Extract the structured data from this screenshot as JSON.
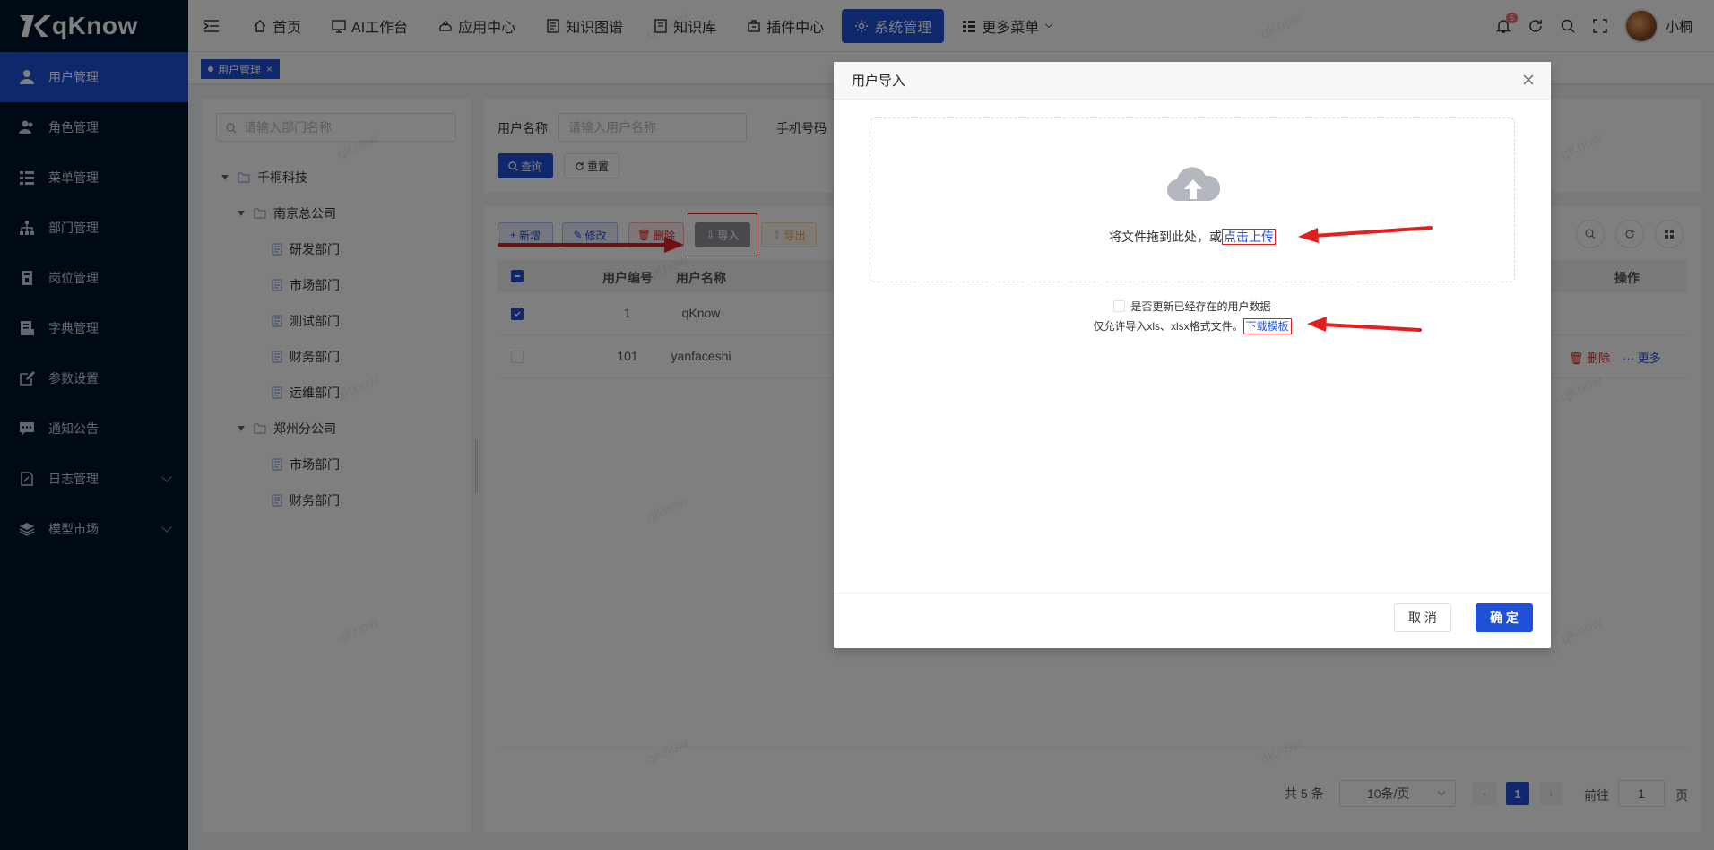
{
  "app": {
    "name": "qKnow",
    "watermark": "qKnow"
  },
  "sidebar": {
    "items": [
      {
        "label": "用户管理",
        "icon": "user-icon",
        "active": true
      },
      {
        "label": "角色管理",
        "icon": "users-icon"
      },
      {
        "label": "菜单管理",
        "icon": "menu-list-icon"
      },
      {
        "label": "部门管理",
        "icon": "org-tree-icon"
      },
      {
        "label": "岗位管理",
        "icon": "post-icon"
      },
      {
        "label": "字典管理",
        "icon": "dict-icon"
      },
      {
        "label": "参数设置",
        "icon": "edit-icon"
      },
      {
        "label": "通知公告",
        "icon": "message-icon"
      },
      {
        "label": "日志管理",
        "icon": "log-icon",
        "expandable": true
      },
      {
        "label": "模型市场",
        "icon": "model-icon",
        "expandable": true
      }
    ]
  },
  "topnav": {
    "items": [
      {
        "label": "首页",
        "icon": "home-icon"
      },
      {
        "label": "AI工作台",
        "icon": "monitor-icon"
      },
      {
        "label": "应用中心",
        "icon": "app-icon"
      },
      {
        "label": "知识图谱",
        "icon": "graph-icon"
      },
      {
        "label": "知识库",
        "icon": "book-icon"
      },
      {
        "label": "插件中心",
        "icon": "plugin-icon"
      },
      {
        "label": "系统管理",
        "icon": "gear-icon",
        "active": true
      },
      {
        "label": "更多菜单",
        "icon": "more-menu-icon"
      }
    ],
    "notification_count": "5",
    "username": "小桐"
  },
  "tags": {
    "active": "用户管理"
  },
  "dept": {
    "search_placeholder": "请输入部门名称",
    "tree": [
      {
        "label": "千桐科技",
        "level": 0,
        "type": "folder",
        "expanded": true
      },
      {
        "label": "南京总公司",
        "level": 1,
        "type": "folder",
        "expanded": true
      },
      {
        "label": "研发部门",
        "level": 2,
        "type": "doc"
      },
      {
        "label": "市场部门",
        "level": 2,
        "type": "doc"
      },
      {
        "label": "测试部门",
        "level": 2,
        "type": "doc"
      },
      {
        "label": "财务部门",
        "level": 2,
        "type": "doc"
      },
      {
        "label": "运维部门",
        "level": 2,
        "type": "doc"
      },
      {
        "label": "郑州分公司",
        "level": 1,
        "type": "folder",
        "expanded": true
      },
      {
        "label": "市场部门",
        "level": 2,
        "type": "doc"
      },
      {
        "label": "财务部门",
        "level": 2,
        "type": "doc"
      }
    ]
  },
  "query": {
    "username_label": "用户名称",
    "username_placeholder": "请输入用户名称",
    "phone_label": "手机号码",
    "search_btn": "查询",
    "reset_btn": "重置"
  },
  "toolbar": {
    "add": "新增",
    "edit": "修改",
    "delete": "删除",
    "import": "导入",
    "export": "导出"
  },
  "table": {
    "headers": [
      "用户编号",
      "用户名称",
      "操作"
    ],
    "rows": [
      {
        "id": "1",
        "name": "qKnow",
        "checked": true
      },
      {
        "id": "101",
        "name": "yanfaceshi",
        "checked": false
      }
    ],
    "row_actions": {
      "delete": "删除",
      "more": "更多"
    }
  },
  "pager": {
    "total": "共 5 条",
    "page_size": "10条/页",
    "current": "1",
    "goto_label": "前往",
    "goto_value": "1",
    "page_unit": "页"
  },
  "dialog": {
    "title": "用户导入",
    "drag_text": "将文件拖到此处，或",
    "click_upload": "点击上传",
    "update_existing": "是否更新已经存在的用户数据",
    "allow_text": "仅允许导入xls、xlsx格式文件。",
    "download_template": "下载模板",
    "cancel": "取 消",
    "confirm": "确 定"
  },
  "colors": {
    "primary": "#1e50d8",
    "sidebar": "#001529",
    "danger": "#e02020",
    "warning": "#e6a23c"
  }
}
